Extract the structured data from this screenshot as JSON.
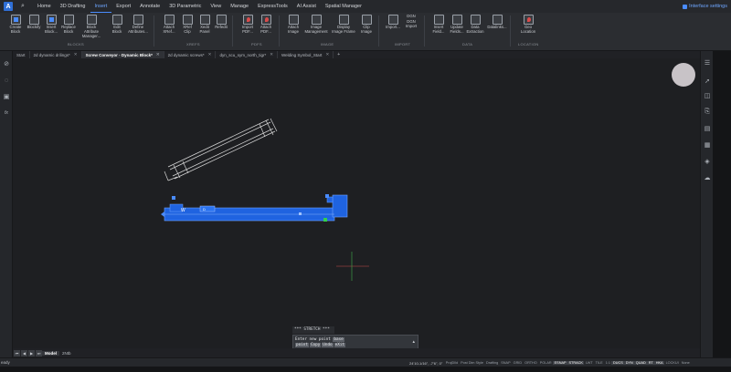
{
  "menu": {
    "logo": "A",
    "items": [
      "Home",
      "3D Drafting",
      "Insert",
      "Export",
      "Annotate",
      "3D Parametric",
      "View",
      "Manage",
      "ExpressTools",
      "AI Assist",
      "Spatial Manager"
    ],
    "active": "Insert",
    "interface_settings": "Interface settings"
  },
  "ribbon": {
    "buttons": [
      {
        "label": "Create\nBlock",
        "icon": "create-block-icon"
      },
      {
        "label": "Blockify",
        "icon": "blockify-icon"
      },
      {
        "label": "Insert\nBlock...",
        "icon": "insert-block-icon"
      },
      {
        "label": "Replace\nBlock",
        "icon": "replace-block-icon"
      },
      {
        "label": "Block Attribute\nManager...",
        "icon": "block-attribute-manager-icon"
      },
      {
        "label": "Edit\nBlock",
        "icon": "edit-block-icon"
      },
      {
        "label": "Define\nAttributes...",
        "icon": "define-attributes-icon"
      },
      {
        "label": "Attach\nXRef...",
        "icon": "attach-xref-icon"
      },
      {
        "label": "XRef\nClip",
        "icon": "xref-clip-icon"
      },
      {
        "label": "Xedit\nPanel",
        "icon": "xedit-panel-icon"
      },
      {
        "label": "Refedit",
        "icon": "refedit-icon"
      },
      {
        "label": "Import\nPDF...",
        "icon": "import-pdf-icon"
      },
      {
        "label": "Attach\nPDF...",
        "icon": "attach-pdf-icon"
      },
      {
        "label": "Attach\nImage",
        "icon": "attach-image-icon"
      },
      {
        "label": "Image\nManagement",
        "icon": "image-management-icon"
      },
      {
        "label": "Display\nImage Frame",
        "icon": "display-image-frame-icon"
      },
      {
        "label": "Clip\nImage",
        "icon": "clip-image-icon"
      },
      {
        "label": "Import...",
        "icon": "import-icon"
      },
      {
        "label": "DGN\nImport",
        "icon": "dgn-import-icon"
      },
      {
        "label": "Insert\nField...",
        "icon": "insert-field-icon"
      },
      {
        "label": "Update\nFields...",
        "icon": "update-fields-icon"
      },
      {
        "label": "Data\nExtraction",
        "icon": "data-extraction-icon"
      },
      {
        "label": "Datalinks...",
        "icon": "datalinks-icon"
      },
      {
        "label": "Geo\nLocation",
        "icon": "geo-location-icon"
      }
    ],
    "groups": [
      "BLOCKS",
      "XREFS",
      "PDFS",
      "IMAGE",
      "IMPORT",
      "DATA",
      "LOCATION"
    ],
    "dgn_label": "DGN"
  },
  "tabs": [
    {
      "label": "Start",
      "active": false
    },
    {
      "label": "2d dynamic drilings*",
      "active": false
    },
    {
      "label": "Screw Conveyor - Dynamic Block*",
      "active": true
    },
    {
      "label": "2d dynamic screws*",
      "active": false
    },
    {
      "label": "dyn_scu_sym_north_tigr*",
      "active": false
    },
    {
      "label": "Welding Symbol_Start",
      "active": false
    }
  ],
  "tab_close": "✕",
  "tab_add": "+",
  "canvas": {
    "stretch_label": "W",
    "stretch_label2": "D"
  },
  "command": {
    "history": "*** STRETCH ***",
    "prompt": "Enter new point",
    "option_base": "base",
    "options": [
      "point",
      "Copy",
      "Undo",
      "eXit"
    ]
  },
  "layout": {
    "tabs": [
      "Model",
      "2Ntb"
    ],
    "active": "Model"
  },
  "status": {
    "left": "eady",
    "coords": "24'10-1/16\", -7'6\", 0\"",
    "items": [
      {
        "label": "ProjDlld",
        "on": false
      },
      {
        "label": "Post Dim Style",
        "on": false
      },
      {
        "label": "Drafting",
        "on": false
      },
      {
        "label": "SNAP",
        "on": false
      },
      {
        "label": "GRID",
        "on": false
      },
      {
        "label": "ORTHO",
        "on": false
      },
      {
        "label": "POLAR",
        "on": false
      },
      {
        "label": "ESNAP",
        "on": true
      },
      {
        "label": "STRACK",
        "on": true
      },
      {
        "label": "LWT",
        "on": false
      },
      {
        "label": "TILE",
        "on": false
      },
      {
        "label": "1:1",
        "on": false
      },
      {
        "label": "DUCS",
        "on": true
      },
      {
        "label": "DYN",
        "on": true
      },
      {
        "label": "QUAD",
        "on": true
      },
      {
        "label": "RT",
        "on": true
      },
      {
        "label": "HKA",
        "on": true
      },
      {
        "label": "LOCKUI",
        "on": false
      },
      {
        "label": "None",
        "on": false
      }
    ]
  },
  "colors": {
    "accent": "#4a8cff",
    "selection_fill": "#1f63e0",
    "background": "#1e1f22"
  }
}
